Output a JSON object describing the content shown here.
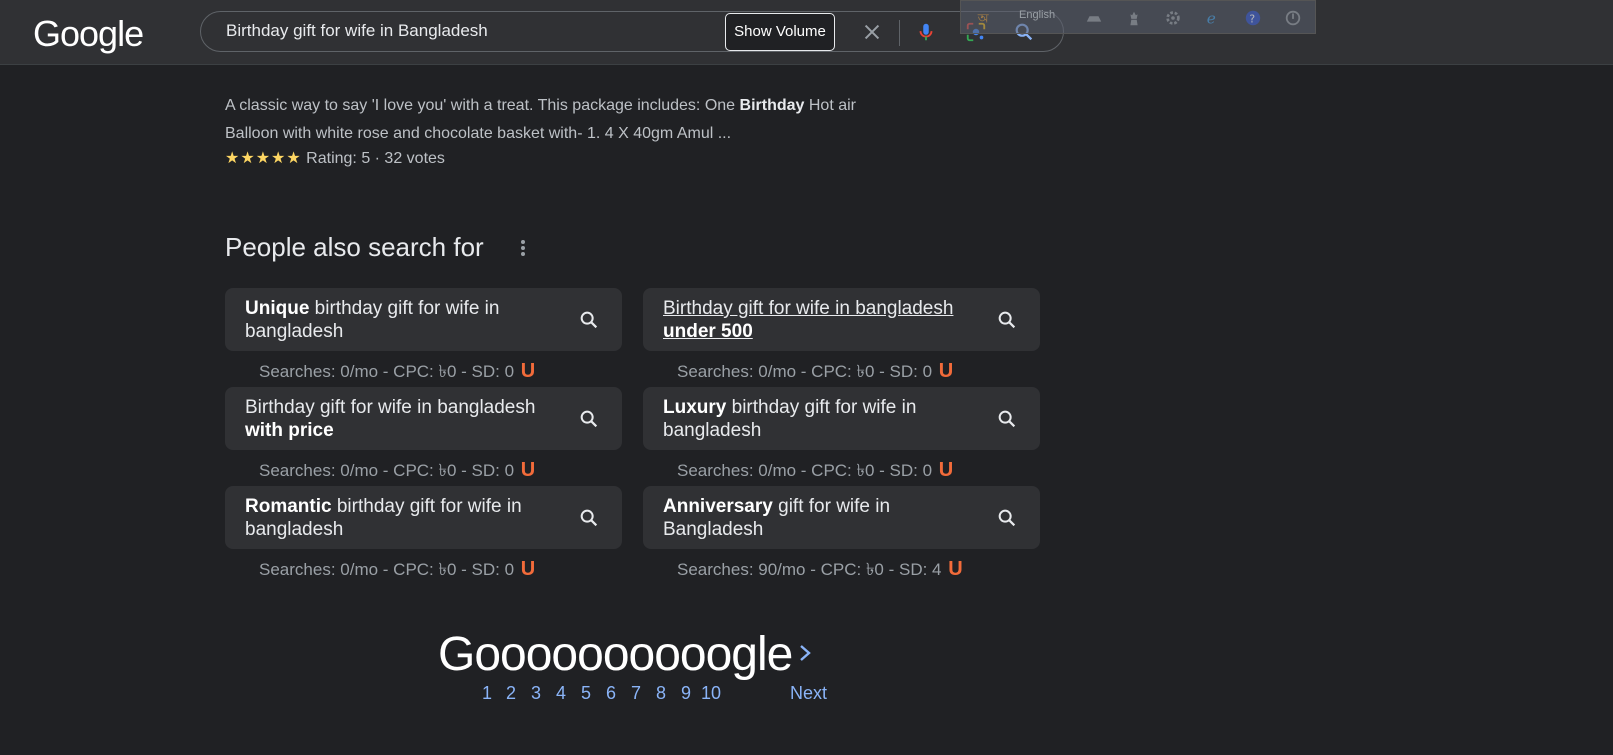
{
  "header": {
    "logo": "Google",
    "search_value": "Birthday gift for wife in Bangladesh",
    "show_volume_label": "Show Volume",
    "toolbar_lang": "English"
  },
  "result": {
    "desc_part1": "A classic way to say 'I love you' with a treat. This package includes: One ",
    "desc_bold": "Birthday",
    "desc_part2": " Hot air Balloon with white rose and chocolate basket with- 1. 4 X 40gm Amul ...",
    "stars": "★★★★★",
    "rating_text": "Rating: 5 · 32 votes"
  },
  "people_also_search": {
    "title": "People also search for",
    "items": [
      {
        "bold": "Unique",
        "rest": " birthday gift for wife in bangladesh",
        "metrics": "Searches: 0/mo - CPC: ৳0 - SD: 0"
      },
      {
        "pre": "Birthday gift for wife in bangladesh ",
        "bold": "under 500",
        "metrics": "Searches: 0/mo - CPC: ৳0 - SD: 0"
      },
      {
        "pre": "Birthday gift for wife in bangladesh ",
        "bold": "with price",
        "metrics": "Searches: 0/mo - CPC: ৳0 - SD: 0"
      },
      {
        "bold": "Luxury",
        "rest": " birthday gift for wife in bangladesh",
        "metrics": "Searches: 0/mo - CPC: ৳0 - SD: 0"
      },
      {
        "bold": "Romantic",
        "rest": " birthday gift for wife in bangladesh",
        "metrics": "Searches: 0/mo - CPC: ৳0 - SD: 0"
      },
      {
        "bold": "Anniversary",
        "rest": " gift for wife in Bangladesh",
        "metrics": "Searches: 90/mo - CPC: ৳0 - SD: 4"
      }
    ],
    "u_badge": "U"
  },
  "pagination": {
    "logo": "Goooooooooogle",
    "pages": [
      "1",
      "2",
      "3",
      "4",
      "5",
      "6",
      "7",
      "8",
      "9",
      "10"
    ],
    "next": "Next"
  },
  "colors": {
    "background": "#202124",
    "link": "#8ab4f8",
    "star": "#fdd663",
    "badge": "#f26b3a"
  }
}
